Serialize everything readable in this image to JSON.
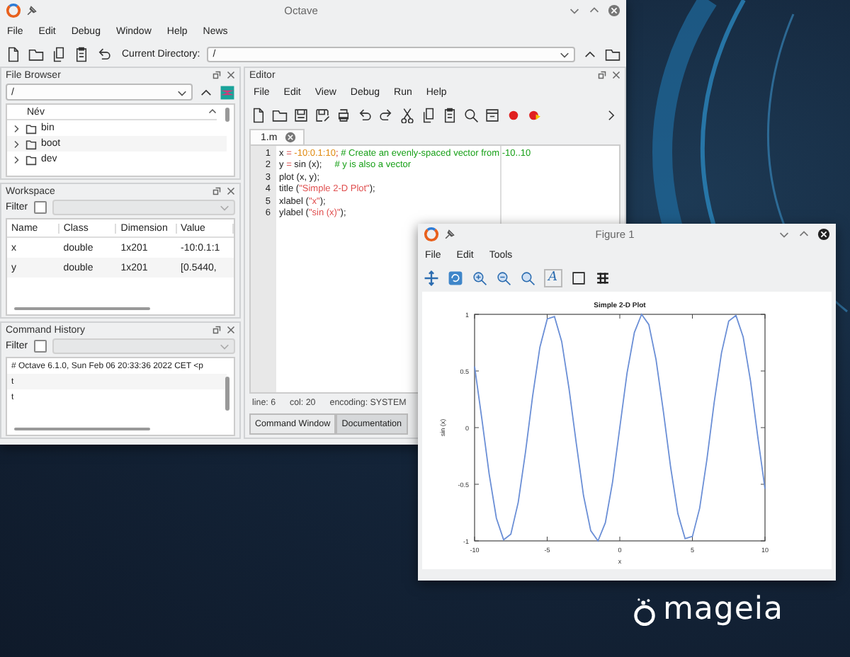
{
  "octave_window": {
    "title": "Octave",
    "menu": [
      "File",
      "Edit",
      "Debug",
      "Window",
      "Help",
      "News"
    ],
    "current_directory_label": "Current Directory:",
    "current_directory": "/"
  },
  "file_browser": {
    "title": "File Browser",
    "path": "/",
    "column": "Név",
    "items": [
      "bin",
      "boot",
      "dev"
    ]
  },
  "workspace": {
    "title": "Workspace",
    "filter_label": "Filter",
    "filter_checked": false,
    "columns": [
      "Name",
      "Class",
      "Dimension",
      "Value"
    ],
    "rows": [
      [
        "x",
        "double",
        "1x201",
        "-10:0.1:1"
      ],
      [
        "y",
        "double",
        "1x201",
        "[0.5440,"
      ]
    ]
  },
  "command_history": {
    "title": "Command History",
    "filter_label": "Filter",
    "filter_checked": false,
    "entries": [
      "# Octave 6.1.0, Sun Feb 06 20:33:36 2022 CET <p",
      "t",
      "t"
    ]
  },
  "editor": {
    "title": "Editor",
    "menu": [
      "File",
      "Edit",
      "View",
      "Debug",
      "Run",
      "Help"
    ],
    "tab": "1.m",
    "lines": [
      {
        "number": "1",
        "tokens": [
          {
            "text": "x ",
            "kind": "plain"
          },
          {
            "text": "= ",
            "kind": "operator"
          },
          {
            "text": "-10:0.1:10",
            "kind": "number"
          },
          {
            "text": "; ",
            "kind": "operator"
          },
          {
            "text": "# Create an evenly-spaced vector from -10..10",
            "kind": "comment"
          }
        ]
      },
      {
        "number": "2",
        "tokens": [
          {
            "text": "y ",
            "kind": "plain"
          },
          {
            "text": "= ",
            "kind": "operator"
          },
          {
            "text": "sin (x);",
            "kind": "plain"
          },
          {
            "text": "     # y is also a vector",
            "kind": "comment"
          }
        ]
      },
      {
        "number": "3",
        "tokens": [
          {
            "text": "plot (x, y);",
            "kind": "plain"
          }
        ]
      },
      {
        "number": "4",
        "tokens": [
          {
            "text": "title (",
            "kind": "plain"
          },
          {
            "text": "\"Simple 2-D Plot\"",
            "kind": "string"
          },
          {
            "text": ");",
            "kind": "plain"
          }
        ]
      },
      {
        "number": "5",
        "tokens": [
          {
            "text": "xlabel (",
            "kind": "plain"
          },
          {
            "text": "\"x\"",
            "kind": "string"
          },
          {
            "text": ");",
            "kind": "plain"
          }
        ]
      },
      {
        "number": "6",
        "tokens": [
          {
            "text": "ylabel (",
            "kind": "plain"
          },
          {
            "text": "\"sin (x)\"",
            "kind": "string"
          },
          {
            "text": ");",
            "kind": "plain"
          }
        ]
      }
    ],
    "status": [
      "line: 6",
      "col: 20",
      "encoding: SYSTEM"
    ]
  },
  "bottom_tabs": [
    {
      "label": "Command Window",
      "selected": true
    },
    {
      "label": "Documentation",
      "selected": false
    }
  ],
  "figure": {
    "title": "Figure 1",
    "menu": [
      "File",
      "Edit",
      "Tools"
    ],
    "text_tool": "A",
    "chart_data": {
      "type": "line",
      "title": "Simple 2-D Plot",
      "xlabel": "x",
      "ylabel": "sin (x)",
      "xlim": [
        -10,
        10
      ],
      "ylim": [
        -1,
        1
      ],
      "xticks": [
        -10,
        -5,
        0,
        5,
        10
      ],
      "yticks": [
        -1,
        -0.5,
        0,
        0.5,
        1
      ],
      "x": [
        -10,
        -9.5,
        -9,
        -8.5,
        -8,
        -7.5,
        -7,
        -6.5,
        -6,
        -5.5,
        -5,
        -4.5,
        -4,
        -3.5,
        -3,
        -2.5,
        -2,
        -1.5,
        -1,
        -0.5,
        0,
        0.5,
        1,
        1.5,
        2,
        2.5,
        3,
        3.5,
        4,
        4.5,
        5,
        5.5,
        6,
        6.5,
        7,
        7.5,
        8,
        8.5,
        9,
        9.5,
        10
      ],
      "series": [
        {
          "color": "#6b8fd6",
          "values": [
            0.54,
            0.08,
            -0.41,
            -0.8,
            -0.99,
            -0.94,
            -0.66,
            -0.22,
            0.28,
            0.71,
            0.96,
            0.98,
            0.76,
            0.35,
            -0.14,
            -0.6,
            -0.91,
            -1,
            -0.84,
            -0.48,
            0,
            0.48,
            0.84,
            1,
            0.91,
            0.6,
            0.14,
            -0.35,
            -0.76,
            -0.98,
            -0.96,
            -0.71,
            -0.28,
            0.22,
            0.66,
            0.94,
            0.99,
            0.8,
            0.41,
            -0.08,
            -0.54
          ]
        }
      ]
    }
  },
  "desktop": {
    "logo_text": "mageia"
  }
}
